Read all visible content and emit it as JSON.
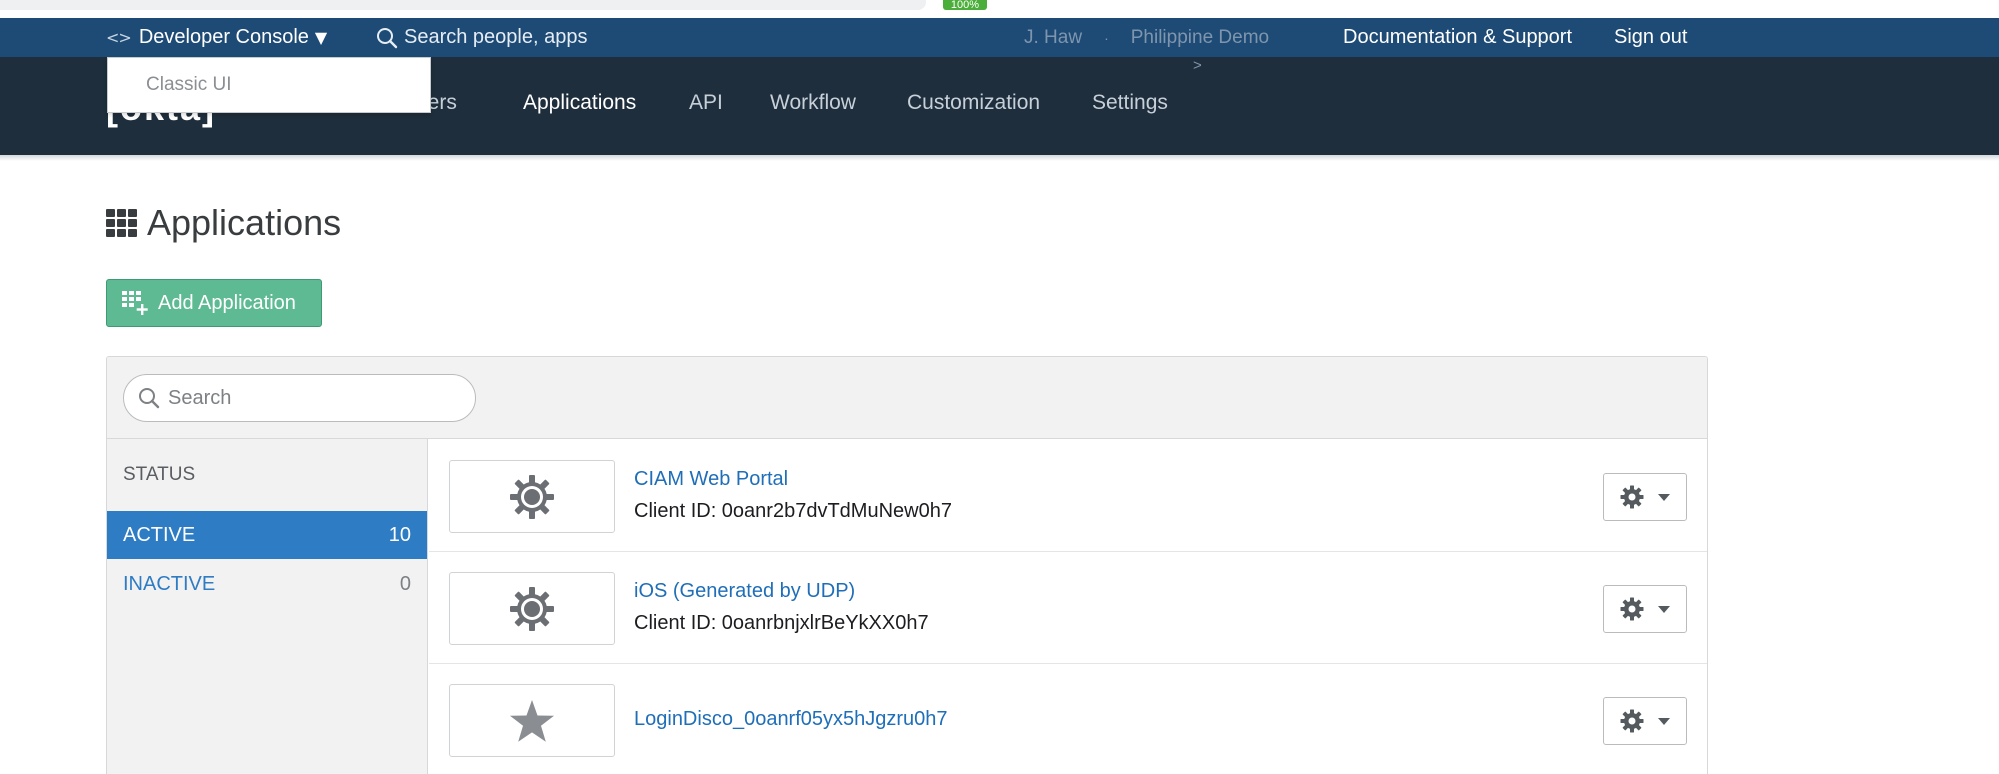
{
  "browser": {
    "zoom": "100%"
  },
  "topbar": {
    "console_label": "Developer Console",
    "search_placeholder": "Search people, apps",
    "user_name": "J. Haw",
    "separator": "·",
    "org_name": "Philippine Demo",
    "breadcrumb_arrow": ">",
    "docs_link": "Documentation & Support",
    "signout_link": "Sign out"
  },
  "dropdown": {
    "items": [
      {
        "label": "Classic UI"
      }
    ]
  },
  "nav": {
    "logo_text": "[okta]",
    "items": [
      {
        "label": "Users",
        "active": false
      },
      {
        "label": "Applications",
        "active": true
      },
      {
        "label": "API",
        "active": false
      },
      {
        "label": "Workflow",
        "active": false
      },
      {
        "label": "Customization",
        "active": false
      },
      {
        "label": "Settings",
        "active": false
      }
    ]
  },
  "page": {
    "title": "Applications",
    "add_button": "Add Application"
  },
  "search": {
    "placeholder": "Search",
    "value": ""
  },
  "sidebar": {
    "heading": "STATUS",
    "items": [
      {
        "label": "ACTIVE",
        "count": "10",
        "selected": true
      },
      {
        "label": "INACTIVE",
        "count": "0",
        "selected": false
      }
    ]
  },
  "apps": [
    {
      "name": "CIAM Web Portal",
      "client_id": "Client ID: 0oanr2b7dvTdMuNew0h7",
      "icon": "gear-icon"
    },
    {
      "name": "iOS (Generated by UDP)",
      "client_id": "Client ID: 0oanrbnjxlrBeYkXX0h7",
      "icon": "gear-icon"
    },
    {
      "name": "LoginDisco_0oanrf05yx5hJgzru0h7",
      "client_id": "",
      "icon": "star-icon"
    }
  ],
  "colors": {
    "topbar": "#1d4b75",
    "navbar": "#1f2e3c",
    "accent_blue": "#2e7cc4",
    "add_button": "#5dba92",
    "link": "#1f6eb8"
  }
}
